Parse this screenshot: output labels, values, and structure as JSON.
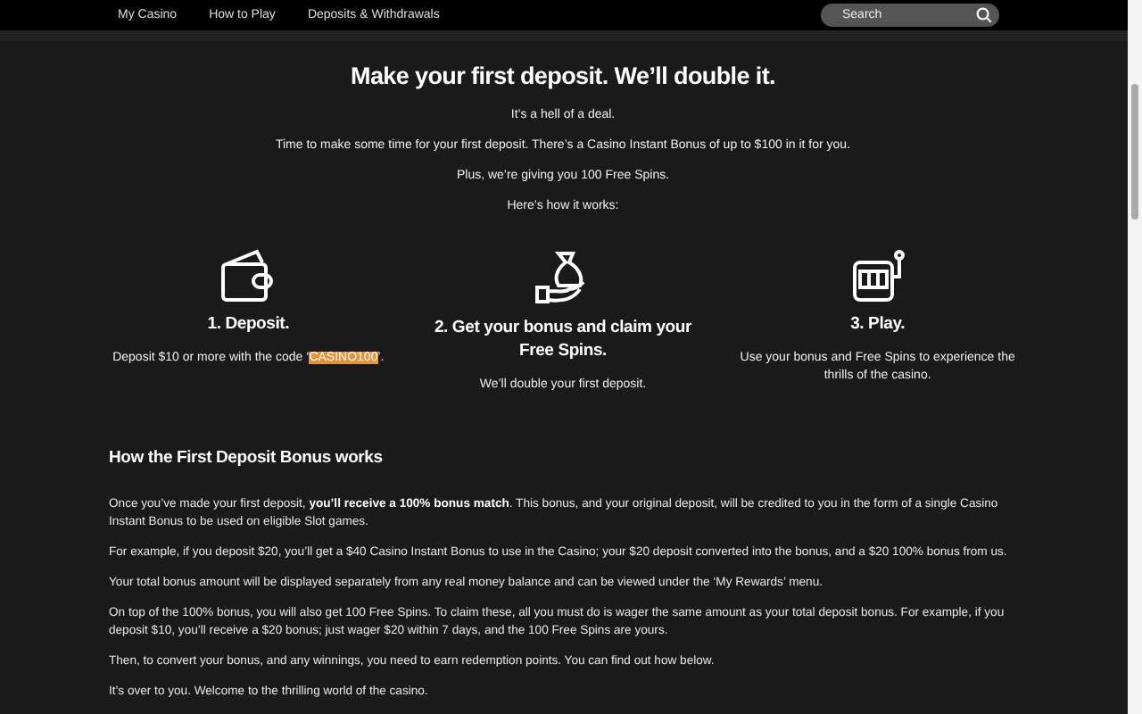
{
  "nav": {
    "items": [
      {
        "label": "My Casino"
      },
      {
        "label": "How to Play"
      },
      {
        "label": "Deposits & Withdrawals"
      }
    ],
    "search": {
      "placeholder": "Search"
    }
  },
  "hero": {
    "title": "Make your first deposit. We’ll double it.",
    "lines": [
      "It’s a hell of a deal.",
      "Time to make some time for your first deposit. There’s a Casino Instant Bonus of up to $100 in it for you.",
      "Plus, we’re giving you 100 Free Spins.",
      "Here’s how it works:"
    ]
  },
  "steps": [
    {
      "kind": "wallet",
      "title": "1. Deposit.",
      "text_before": "Deposit $10 or more with the code ‘",
      "code": "CASINO100",
      "text_after": "’."
    },
    {
      "kind": "bag",
      "title": "2. Get your bonus and claim your Free Spins.",
      "text": "We’ll double your first deposit."
    },
    {
      "kind": "slot",
      "title": "3. Play.",
      "text": "Use your bonus and Free Spins to experience the thrills of the casino."
    }
  ],
  "details": {
    "title": "How the First Deposit Bonus works",
    "paragraphs": [
      "Once you’ve made your first deposit, **you’ll receive a 100% bonus match**. This bonus, and your original deposit, will be credited to you in the form of a single Casino Instant Bonus to be used on eligible Slot games.",
      "For example, if you deposit $20, you’ll get a $40 Casino Instant Bonus to use in the Casino; your $20 deposit converted into the bonus, and a $20 100% bonus from us.",
      "Your total bonus amount will be displayed separately from any real money balance and can be viewed under the ‘My Rewards’ menu.",
      "On top of the 100% bonus, you will also get 100 Free Spins. To claim these, all you must do is wager the same amount as your total deposit bonus. For example, if you deposit $10, you’ll receive a $20 bonus; just wager $20 within 7 days, and the 100 Free Spins are yours.",
      "Then, to convert your bonus, and any winnings, you need to earn redemption points. You can find out how below.",
      "It’s over to you. Welcome to the thrilling world of the casino."
    ]
  }
}
